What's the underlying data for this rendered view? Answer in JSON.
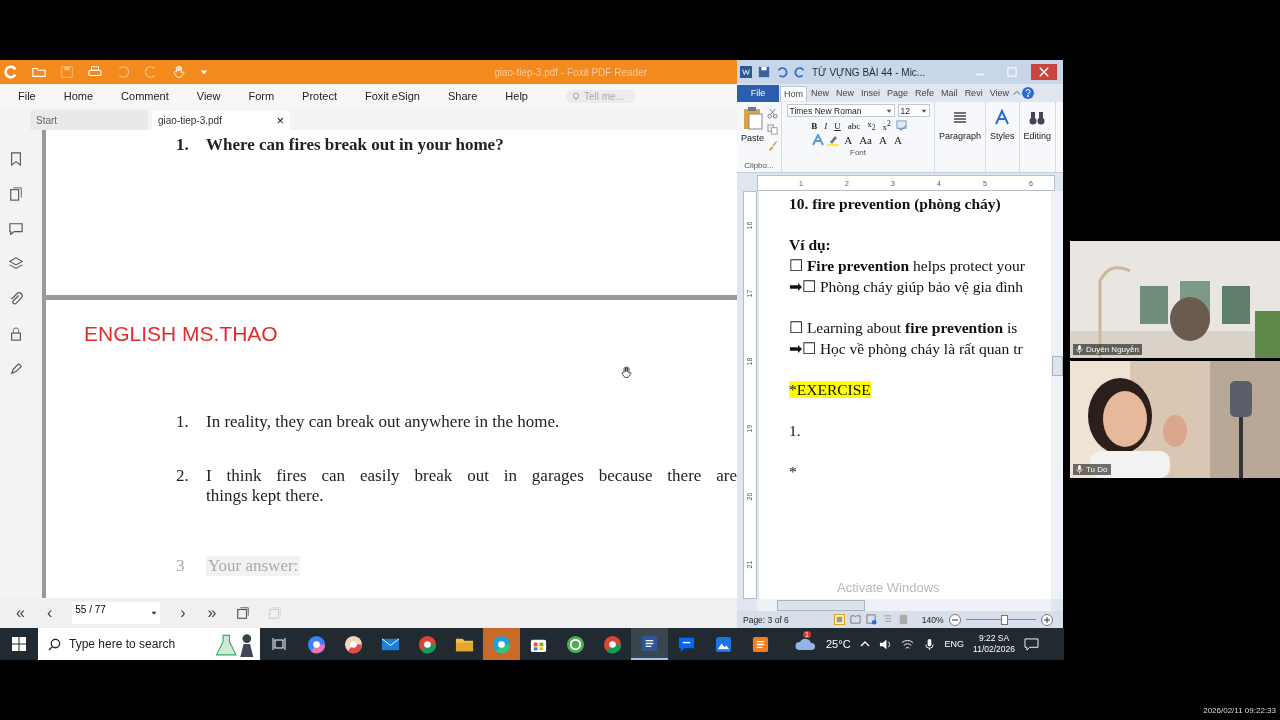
{
  "pdf_window": {
    "title": "giao-tiep-3.pdf - Foxit PDF Reader",
    "menu": [
      "File",
      "Home",
      "Comment",
      "View",
      "Form",
      "Protect",
      "Foxit eSign",
      "Share",
      "Help"
    ],
    "search": {
      "placeholder": "Tell me..."
    },
    "tabs": [
      {
        "label": "Start",
        "selected": false
      },
      {
        "label": "giao-tiep-3.pdf",
        "selected": true,
        "close": "×"
      }
    ],
    "pages": [
      {
        "items": [
          {
            "number": "1.",
            "kind": "question",
            "lines": [
              "Where can fires break out in your home?"
            ]
          }
        ]
      },
      {
        "header": "ENGLISH MS.THAO",
        "items": [
          {
            "number": "1.",
            "kind": "answer",
            "lines": [
              "In reality, they can break out anywhere in the home."
            ]
          },
          {
            "number": "2.",
            "kind": "answer",
            "lines": [
              "I think fires can easily break out in garages because there are",
              "things kept there."
            ]
          },
          {
            "number": "3",
            "kind": "hint",
            "lines": [
              "Your answer:"
            ]
          }
        ]
      }
    ],
    "nav_back": [
      "«",
      "‹"
    ],
    "page_field": "55 / 77",
    "nav_forward": [
      "›",
      "»"
    ]
  },
  "word_window": {
    "title": "TỪ VỰNG BÀI 44 - Mic...",
    "file_tab": "File",
    "tabs": [
      {
        "label": "Hom",
        "selected": true
      },
      {
        "label": "New",
        "selected": false
      },
      {
        "label": "New",
        "selected": false
      },
      {
        "label": "Insei",
        "selected": false
      },
      {
        "label": "Page",
        "selected": false
      },
      {
        "label": "Refe",
        "selected": false
      },
      {
        "label": "Mail",
        "selected": false
      },
      {
        "label": "Revi",
        "selected": false
      },
      {
        "label": "View",
        "selected": false
      }
    ],
    "paste": "Paste",
    "clipboard_label": "Clipbo...",
    "font_name": "Times New Roman",
    "font_size": "12",
    "format_buttons": [
      "B",
      "I",
      "U",
      "abc",
      "x$_{2}$",
      "x$^{2}$"
    ],
    "font_buttons": [
      "A",
      "Aa",
      "A",
      "A"
    ],
    "font_label": "Font",
    "big_buttons": [
      "Paragraph",
      "Styles",
      "Editing"
    ],
    "ruler": [
      "1",
      "2",
      "3",
      "4",
      "5",
      "6"
    ],
    "vruler": [
      "16",
      "17",
      "18",
      "19",
      "20",
      "21"
    ],
    "paragraphs": [
      [
        {
          "kind": "heading",
          "text": "10. fire prevention (phòng cháy)"
        }
      ],
      [
        {
          "kind": "heading",
          "text": "Ví dụ:"
        },
        {
          "kind": "text",
          "text": "☐ **Fire prevention** helps protect your"
        },
        {
          "kind": "text",
          "text": "➡☐ Phòng cháy giúp bảo vệ gia đình"
        }
      ],
      [
        {
          "kind": "text",
          "text": "☐ Learning about **fire prevention** is"
        },
        {
          "kind": "text",
          "text": "➡☐ Học về phòng cháy là rất quan tr"
        }
      ],
      [
        {
          "kind": "highlight",
          "text": "*EXERCISE"
        }
      ],
      [
        {
          "kind": "text",
          "text": "1."
        }
      ],
      [
        {
          "kind": "text",
          "text": "*"
        }
      ]
    ],
    "watermark": "Activate Windows",
    "status": "Page: 3 of 6",
    "zoom": {
      "reading": "140%",
      "level": 0.55
    }
  },
  "taskbar": {
    "search": {
      "placeholder": "Type here to search"
    },
    "apps": [
      {
        "kind": "swirl",
        "active": false,
        "flashing": false
      },
      {
        "kind": "palette",
        "active": false,
        "flashing": false
      },
      {
        "kind": "mail",
        "active": false,
        "flashing": false
      },
      {
        "kind": "browser",
        "active": false,
        "flashing": false
      },
      {
        "kind": "folder",
        "active": false,
        "flashing": false
      },
      {
        "kind": "edge",
        "active": false,
        "flashing": true
      },
      {
        "kind": "store",
        "active": false,
        "flashing": false
      },
      {
        "kind": "ring",
        "active": false,
        "flashing": false
      },
      {
        "kind": "browser",
        "active": false,
        "flashing": false
      },
      {
        "kind": "word",
        "active": true,
        "flashing": false
      },
      {
        "kind": "chat",
        "active": false,
        "flashing": false
      },
      {
        "kind": "app",
        "active": false,
        "flashing": false
      },
      {
        "kind": "pdf",
        "active": false,
        "flashing": false
      }
    ],
    "weather_badge": "1",
    "temperature": "25°C",
    "language": "ENG",
    "time": "9:22 SA",
    "date": "11/02/2026"
  },
  "video_tiles": [
    {
      "name": "Duyên Nguyễn",
      "kind": "room"
    },
    {
      "name": "Tu Do",
      "kind": "studio"
    }
  ],
  "timestamp": "2026/02/11 09:22:33"
}
